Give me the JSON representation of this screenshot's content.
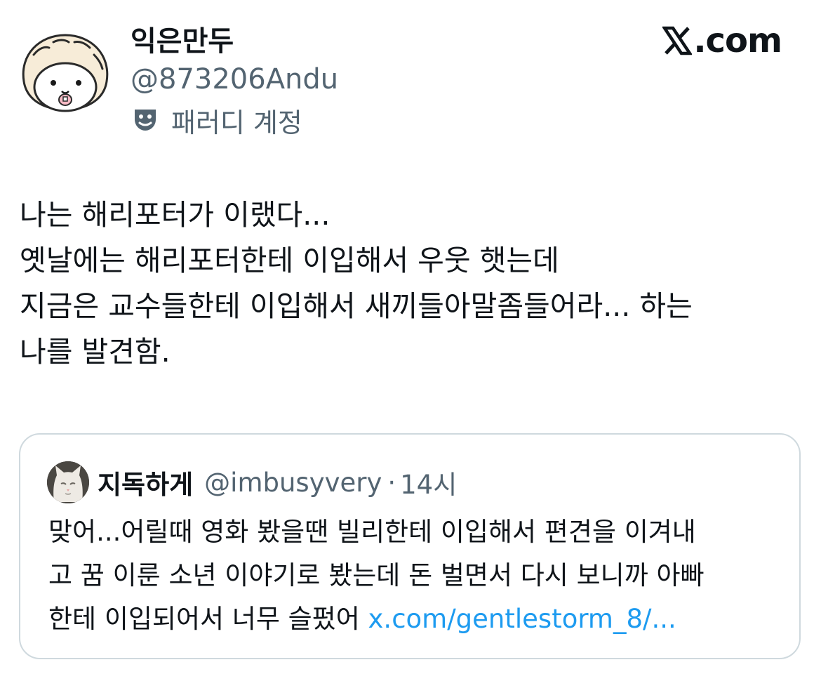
{
  "author": {
    "display_name": "익은만두",
    "handle": "@873206Andu",
    "parody_label": "패러디 계정",
    "parody_icon": "theater-mask-icon",
    "avatar": "dumpling-hamster-avatar"
  },
  "brand": {
    "label": ".com",
    "logo_icon": "x-logo-icon"
  },
  "tweet": {
    "lines": [
      "나는 해리포터가 이랬다...",
      "옛날에는 해리포터한테 이입해서 우웃 햇는데",
      "지금은 교수들한테 이입해서 새끼들아말좀들어라... 하는",
      "나를 발견함."
    ]
  },
  "quote": {
    "display_name": "지독하게",
    "handle": "@imbusyvery",
    "separator": "·",
    "time": "14시",
    "avatar": "white-cat-avatar",
    "lines": [
      "맞어...어릴때 영화 봤을땐 빌리한테 이입해서 편견을 이겨내",
      "고 꿈 이룬 소년 이야기로 봤는데 돈 벌면서 다시 보니까 아빠",
      "한테 이입되어서 너무 슬펐어 "
    ],
    "link": "x.com/gentlestorm_8/..."
  },
  "colors": {
    "text": "#0f1419",
    "secondary": "#536471",
    "link": "#1d9bf0",
    "border": "#cfd9de"
  }
}
